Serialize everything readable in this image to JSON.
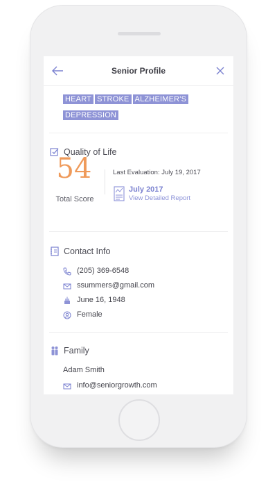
{
  "screen": {
    "title": "Senior Profile",
    "back_icon": "arrow-left-icon",
    "close_icon": "close-icon"
  },
  "conditions": [
    "HEART",
    "STROKE",
    "ALZHEIMER'S",
    "DEPRESSION"
  ],
  "quality_of_life": {
    "heading": "Quality of Life",
    "score": "54",
    "score_label": "Total Score",
    "last_evaluation": "Last Evaluation: July 19, 2017",
    "report_month": "July 2017",
    "report_link": "View Detailed Report"
  },
  "contact_info": {
    "heading": "Contact Info",
    "phone": "(205) 369-6548",
    "email": "ssummers@gmail.com",
    "birthday": "June 16, 1948",
    "gender": "Female"
  },
  "family": {
    "heading": "Family",
    "name": "Adam Smith",
    "email": "info@seniorgrowth.com"
  },
  "colors": {
    "accent": "#8e93d6",
    "score": "#ef9a5a",
    "link": "#8c92d8"
  }
}
